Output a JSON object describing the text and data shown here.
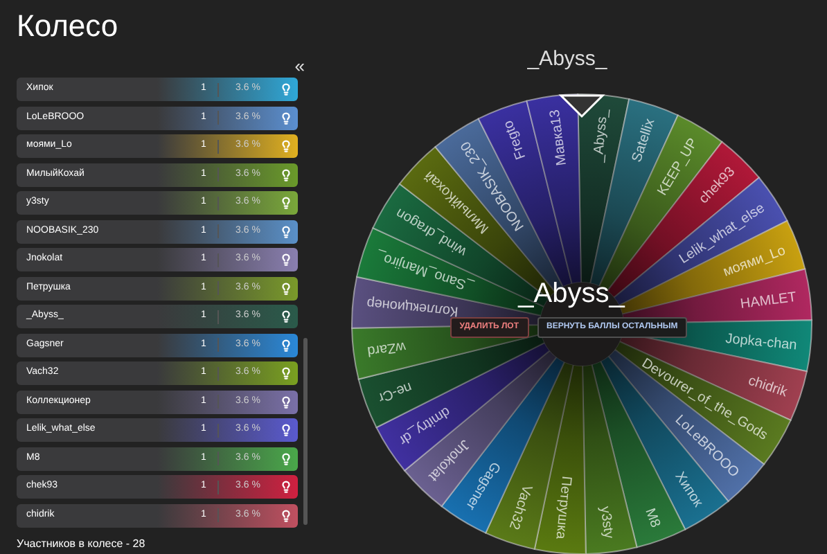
{
  "title": "Колесо",
  "collapse_button": "«",
  "participants": [
    {
      "name": "Хипок",
      "count": "1",
      "share": "3.6 %",
      "color": "#2fa8d8"
    },
    {
      "name": "LoLeBROOO",
      "count": "1",
      "share": "3.6 %",
      "color": "#5b8fd0"
    },
    {
      "name": "моями_Lo",
      "count": "1",
      "share": "3.6 %",
      "color": "#e0b020"
    },
    {
      "name": "МилыйКохай",
      "count": "1",
      "share": "3.6 %",
      "color": "#6a9a2a"
    },
    {
      "name": "y3sty",
      "count": "1",
      "share": "3.6 %",
      "color": "#7aa83a"
    },
    {
      "name": "NOOBASIK_230",
      "count": "1",
      "share": "3.6 %",
      "color": "#5a90c8"
    },
    {
      "name": "Jnokolat",
      "count": "1",
      "share": "3.6 %",
      "color": "#8a7fb0"
    },
    {
      "name": "Петрушка",
      "count": "1",
      "share": "3.6 %",
      "color": "#7a9a2a"
    },
    {
      "name": "_Abyss_",
      "count": "1",
      "share": "3.6 %",
      "color": "#2a5a4a"
    },
    {
      "name": "Gagsner",
      "count": "1",
      "share": "3.6 %",
      "color": "#2a88d8"
    },
    {
      "name": "Vach32",
      "count": "1",
      "share": "3.6 %",
      "color": "#7aa020"
    },
    {
      "name": "Коллекционер",
      "count": "1",
      "share": "3.6 %",
      "color": "#7a70a8"
    },
    {
      "name": "Lelik_what_else",
      "count": "1",
      "share": "3.6 %",
      "color": "#5a5ad0"
    },
    {
      "name": "M8",
      "count": "1",
      "share": "3.6 %",
      "color": "#4aa84a"
    },
    {
      "name": "chek93",
      "count": "1",
      "share": "3.6 %",
      "color": "#d02040"
    },
    {
      "name": "chidrik",
      "count": "1",
      "share": "3.6 %",
      "color": "#c05060"
    }
  ],
  "participants_total": "Участников в колесе - 28",
  "wheel": {
    "winner": "_Abyss_",
    "center_label": "_Abyss_",
    "buttons": [
      {
        "label": "УДАЛИТЬ ЛОТ",
        "kind": "danger"
      },
      {
        "label": "ВЕРНУТЬ БАЛЛЫ ОСТАЛЬНЫМ",
        "kind": "normal"
      }
    ],
    "segments": [
      {
        "label": "_Abyss_",
        "color": "#1f4a3a"
      },
      {
        "label": "Satellix",
        "color": "#2a7080"
      },
      {
        "label": "KEEP_UP",
        "color": "#5a8a2a"
      },
      {
        "label": "chek93",
        "color": "#b01838"
      },
      {
        "label": "Lelik_what_else",
        "color": "#4a50b0"
      },
      {
        "label": "моями_Lo",
        "color": "#c8a010"
      },
      {
        "label": "HAMLET",
        "color": "#b02860"
      },
      {
        "label": "Jopka-chan",
        "color": "#108878"
      },
      {
        "label": "chidrik",
        "color": "#a04050"
      },
      {
        "label": "Devourer_of_the_Gods",
        "color": "#5a7a20"
      },
      {
        "label": "LoLeBROOO",
        "color": "#5070a8"
      },
      {
        "label": "Хипок",
        "color": "#1a7090"
      },
      {
        "label": "M8",
        "color": "#2a7a3a"
      },
      {
        "label": "y3sty",
        "color": "#4a7a20"
      },
      {
        "label": "Петрушка",
        "color": "#5a7a10"
      },
      {
        "label": "Vach32",
        "color": "#5a7a18"
      },
      {
        "label": "Gagsner",
        "color": "#1870b0"
      },
      {
        "label": "Jnokolat",
        "color": "#6a6090"
      },
      {
        "label": "dmitry_dr",
        "color": "#4030a0"
      },
      {
        "label": "ne-Cr",
        "color": "#1a5030"
      },
      {
        "label": "wZard",
        "color": "#3a7a2a"
      },
      {
        "label": "Коллекционер",
        "color": "#5a5080"
      },
      {
        "label": "_Sano_Manjiro_",
        "color": "#1a7a3a"
      },
      {
        "label": "wind_dragon",
        "color": "#1a6a40"
      },
      {
        "label": "МилыйКохай",
        "color": "#5a6a10"
      },
      {
        "label": "NOOBASIK_230",
        "color": "#4a6a9a"
      },
      {
        "label": "Fregto",
        "color": "#3a30a0"
      },
      {
        "label": "Мавка13",
        "color": "#3a30a0"
      }
    ]
  }
}
